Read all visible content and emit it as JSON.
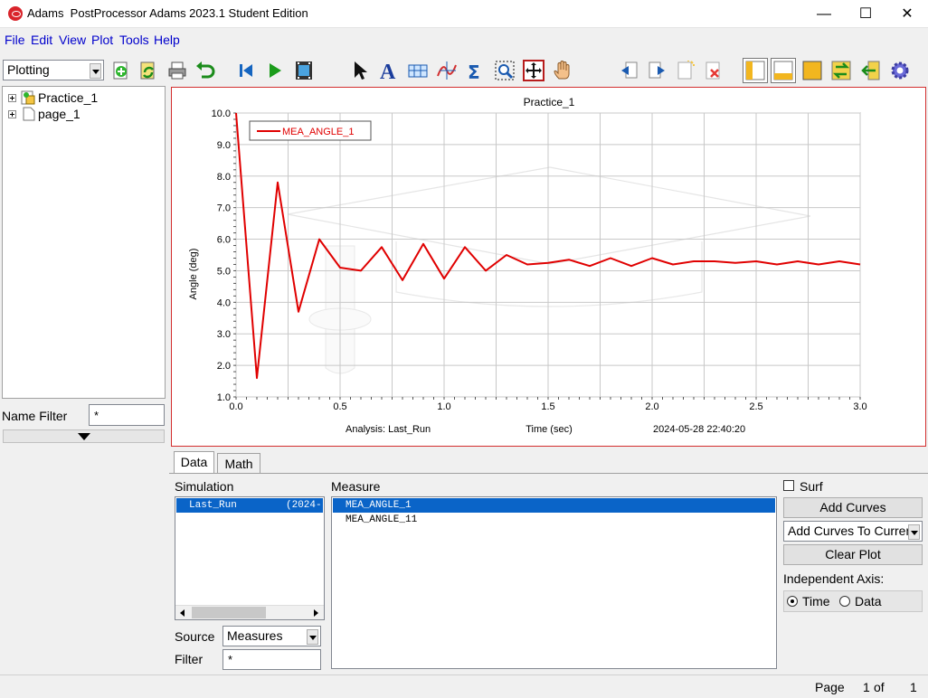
{
  "window": {
    "title": "Adams  PostProcessor Adams 2023.1 Student Edition",
    "minimize": "—",
    "maximize": "☐",
    "close": "✕"
  },
  "menu": [
    "File",
    "Edit",
    "View",
    "Plot",
    "Tools",
    "Help"
  ],
  "toolbar": {
    "mode_value": "Plotting",
    "icons": [
      "add-page-icon",
      "reload-icon",
      "print-icon",
      "undo-icon",
      "rewind-icon",
      "play-icon",
      "animation-icon",
      "select-arrow-icon",
      "text-icon",
      "table-icon",
      "curve-edit-icon",
      "sum-icon",
      "zoom-fit-icon",
      "zoom-box-icon",
      "pan-hand-icon",
      "previous-page-icon",
      "next-page-icon",
      "new-page-icon",
      "delete-page-icon",
      "layout-left-icon",
      "layout-bottom-icon",
      "layout-fill-icon",
      "exchange-icon",
      "back-icon",
      "settings-gear-icon"
    ]
  },
  "tree": {
    "nodes": [
      "Practice_1",
      "page_1"
    ]
  },
  "name_filter": {
    "label": "Name Filter",
    "value": "*"
  },
  "plot": {
    "title": "Practice_1",
    "analysis_label": "Analysis:  Last_Run",
    "timestamp": "2024-05-28 22:40:20",
    "border_color": "#d32f2f"
  },
  "chart_data": {
    "type": "line",
    "title": "Practice_1",
    "xlabel": "Time (sec)",
    "ylabel": "Angle (deg)",
    "xlim": [
      0.0,
      3.0
    ],
    "ylim": [
      1.0,
      10.0
    ],
    "xticks": [
      "0.0",
      "0.5",
      "1.0",
      "1.5",
      "2.0",
      "2.5",
      "3.0"
    ],
    "yticks": [
      "1.0",
      "2.0",
      "3.0",
      "4.0",
      "5.0",
      "6.0",
      "7.0",
      "8.0",
      "9.0",
      "10.0"
    ],
    "grid": true,
    "legend_placement": "top-left",
    "series": [
      {
        "name": "MEA_ANGLE_1",
        "color": "#e00000",
        "x": [
          0.0,
          0.1,
          0.2,
          0.3,
          0.4,
          0.5,
          0.6,
          0.7,
          0.8,
          0.9,
          1.0,
          1.1,
          1.2,
          1.3,
          1.4,
          1.5,
          1.6,
          1.7,
          1.8,
          1.9,
          2.0,
          2.1,
          2.2,
          2.3,
          2.4,
          2.5,
          2.6,
          2.7,
          2.8,
          2.9,
          3.0
        ],
        "y": [
          10.0,
          1.6,
          7.8,
          3.7,
          6.0,
          5.1,
          5.0,
          5.75,
          4.7,
          5.85,
          4.75,
          5.75,
          5.0,
          5.5,
          5.2,
          5.25,
          5.35,
          5.15,
          5.4,
          5.15,
          5.4,
          5.2,
          5.3,
          5.3,
          5.25,
          5.3,
          5.2,
          5.3,
          5.2,
          5.3,
          5.2
        ]
      }
    ]
  },
  "data_tabs": [
    "Data",
    "Math"
  ],
  "simulation": {
    "label": "Simulation",
    "items": [
      {
        "name": "Last_Run",
        "date": "(2024-"
      }
    ]
  },
  "measure": {
    "label": "Measure",
    "items": [
      "MEA_ANGLE_1",
      "MEA_ANGLE_11"
    ]
  },
  "source": {
    "label": "Source",
    "value": "Measures"
  },
  "filter": {
    "label": "Filter",
    "value": "*"
  },
  "surf_label": "Surf",
  "add_curves_label": "Add Curves",
  "add_mode_value": "Add Curves To Current",
  "clear_plot_label": "Clear Plot",
  "independent_axis": {
    "label": "Independent Axis:",
    "options": [
      "Time",
      "Data"
    ],
    "selected": "Time"
  },
  "status": {
    "page_label": "Page",
    "page_current": "1",
    "of_label": "of",
    "page_total": "1"
  }
}
